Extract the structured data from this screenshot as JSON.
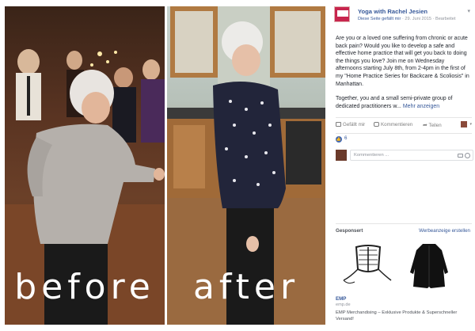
{
  "photos": {
    "before_caption": "before",
    "after_caption": "after"
  },
  "post": {
    "page_name": "Yoga with Rachel Jesien",
    "page_liked": "Diese Seite gefällt mir",
    "date": "29. Juni 2015",
    "edited": "Bearbeitet",
    "text_1": "Are you or a loved one suffering from chronic or acute back pain? Would you like to develop a safe and effective home practice that will get you back to doing the things you love? Join me on Wednesday afternoons starting July 8th, from 2-4pm in the first of my \"Home Practice Series for Backcare & Scoliosis\" in Manhattan.",
    "text_2": "Together, you and a small semi-private group of dedicated practitioners w...",
    "see_more": "Mehr anzeigen"
  },
  "actions": {
    "like": "Gefällt mir",
    "comment": "Kommentieren",
    "share": "Teilen"
  },
  "reactions": {
    "count": "6"
  },
  "comment_box": {
    "placeholder": "Kommentieren ..."
  },
  "ads": {
    "title": "Gesponsert",
    "create": "Werbeanzeige erstellen",
    "brand": "EMP",
    "url": "emp.de",
    "description": "EMP Merchandising – Exklusive Produkte & Superschneller Versand!"
  },
  "colors": {
    "link": "#365899",
    "meta": "#90949c",
    "text": "#1d2129"
  },
  "icons": [
    "like-icon",
    "comment-icon",
    "share-icon",
    "camera-icon",
    "smiley-icon",
    "chevron-down-icon",
    "reaction-like-icon"
  ]
}
